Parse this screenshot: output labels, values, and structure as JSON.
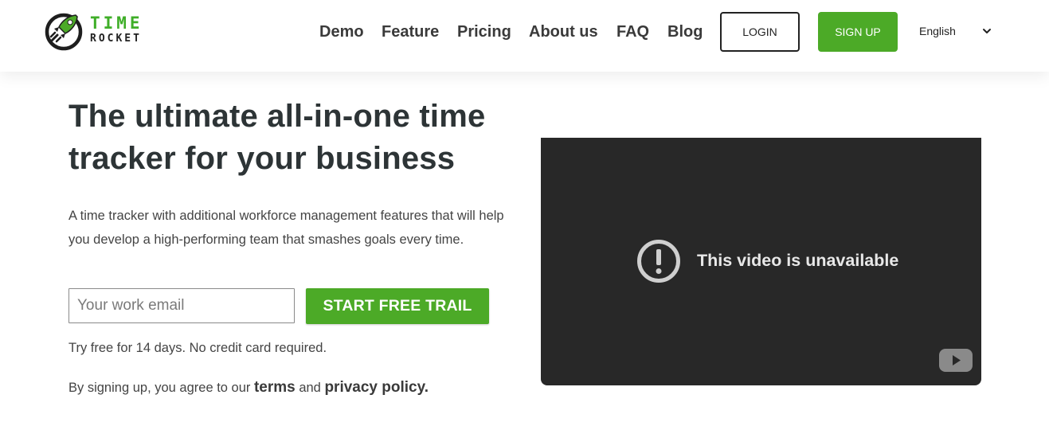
{
  "brand": {
    "line1": "TIME",
    "line2": "ROCKET",
    "icon": "rocket-logo-icon",
    "accent_color": "#4caa27"
  },
  "nav": {
    "items": [
      "Demo",
      "Feature",
      "Pricing",
      "About us",
      "FAQ",
      "Blog"
    ],
    "login_label": "LOGIN",
    "signup_label": "SIGN UP",
    "language": "English"
  },
  "hero": {
    "title_line1": "The ultimate all-in-one time",
    "title_line2": "tracker for your business",
    "description": "A time tracker with additional workforce management features that will help you develop a high-performing team that smashes goals every time.",
    "email_placeholder": "Your work email",
    "cta_label": "START FREE TRAIL",
    "trial_note": "Try free for 14 days. No credit card required.",
    "terms_prefix": "By signing up, you agree to our ",
    "terms_link": "terms",
    "terms_and": " and ",
    "privacy_link": "privacy policy."
  },
  "video": {
    "message": "This video is unavailable",
    "alert_icon": "alert-circle-icon",
    "platform_icon": "youtube-logo-icon"
  }
}
